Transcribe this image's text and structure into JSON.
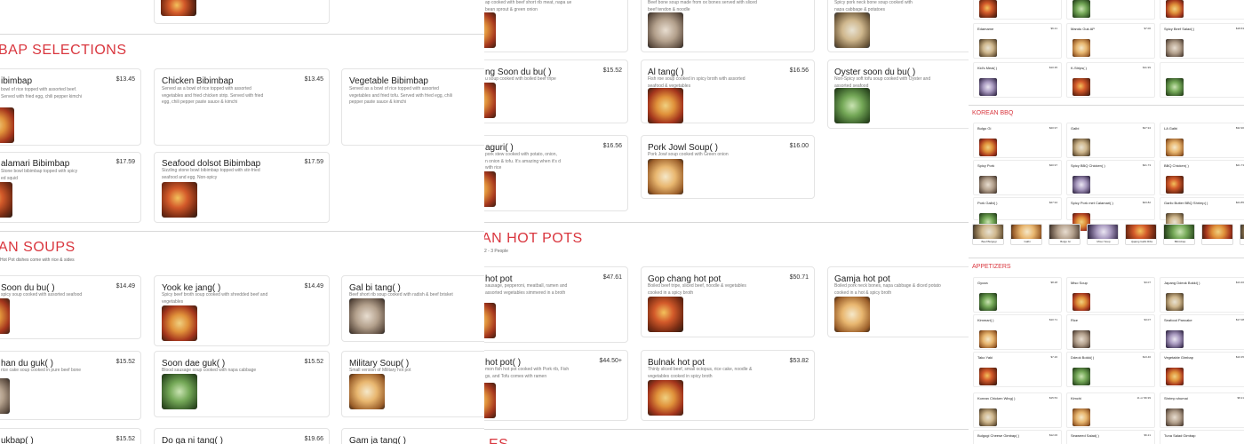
{
  "panel1": {
    "bap": {
      "title": "BAP SELECTIONS",
      "items": [
        {
          "name": "ibimbap",
          "price": "$13.45",
          "desc": "bowl of rice topped with assorted beef. Served with fried egg, chili pepper kimchi"
        },
        {
          "name": "Chicken Bibimbap",
          "price": "$13.45",
          "desc": "Served as a bowl of rice topped with assorted vegetables and fried chicken strip. Served with fried egg, chili pepper paste sauce & kimchi"
        },
        {
          "name": "Vegetable Bibimbap",
          "price": "",
          "desc": "Served as a bowl of rice topped with assorted vegetables and fried tofu. Served with fried egg, chili pepper paste sauce & kimchi"
        },
        {
          "name": "alamari Bibimbap",
          "price": "$17.59",
          "desc": "Stone bowl bibimbap topped with spicy ed squid"
        },
        {
          "name": "Seafood dolsot Bibimbap",
          "price": "$17.59",
          "desc": "Sizzling stone bowl bibimbap topped with stir-fried seafood and egg. Non-spicy"
        }
      ]
    },
    "soups": {
      "title": "AN SOUPS",
      "subtitle": "Hot Pot dishes come with rice & sides",
      "items": [
        {
          "name": "Soon du bu(   )",
          "price": "$14.49",
          "desc": "spicy soup cooked with assorted seafood"
        },
        {
          "name": "Yook ke jang(   )",
          "price": "$14.49",
          "desc": "Spicy beef broth soup cooked with shredded beef and vegetables"
        },
        {
          "name": "Gal bi tang(   )",
          "price": "",
          "desc": "Beef short rib soup cooked with radish & beef brisket"
        },
        {
          "name": "han du guk(   )",
          "price": "$15.52",
          "desc": "rice cake soup cooked in pure beef bone"
        },
        {
          "name": "Soon dae guk(   )",
          "price": "$15.52",
          "desc": "Blood sausage soup cooked with napa cabbage"
        },
        {
          "name": "Military Soup(   )",
          "price": "",
          "desc": "Small version of Military hot pot"
        },
        {
          "name": "ukbap(   )",
          "price": "$15.52",
          "desc": ""
        },
        {
          "name": "Do ga ni tang(   )",
          "price": "$19.66",
          "desc": ""
        },
        {
          "name": "Gam ja tang(   )",
          "price": "",
          "desc": ""
        }
      ]
    }
  },
  "panel2": {
    "top": [
      {
        "name": "",
        "price": "",
        "desc": "ap cooked with beef short rib meat, napa ue bean sprout & green onion"
      },
      {
        "name": "",
        "price": "",
        "desc": "Beef bone soup made from ox bones served with sliced beef tendon & noodle"
      },
      {
        "name": "",
        "price": "",
        "desc": "Spicy pork neck bone soup cooked with napa cabbage & potatoes"
      }
    ],
    "soups2": [
      {
        "name": "ng Soon du bu(   )",
        "price": "$15.52",
        "desc": "u soup cooked with boiled beef tripe"
      },
      {
        "name": "Al tang(   )",
        "price": "$16.56",
        "desc": "Fish roe soup cooked in spicy broth with assorted seafood & vegetables"
      },
      {
        "name": "Oyster soon du bu(   )",
        "price": "",
        "desc": "Non-Spicy soft tofu soup cooked with Oyster and assorted seafood"
      },
      {
        "name": "aguri(   )",
        "price": "$16.56",
        "desc": "pork stew cooked with potato, onion, n onion & tofu. It's amazing when it's d with rice"
      },
      {
        "name": "Pork Jowl Soup(   )",
        "price": "$16.00",
        "desc": "Pork Jowl soup cooked with Green onion"
      }
    ],
    "hotpots": {
      "title": "AN HOT POTS",
      "subtitle": "2 - 3 People",
      "items": [
        {
          "name": "hot pot",
          "price": "$47.61",
          "desc": "sausage, pepperoni, meatball, ramen and assorted vegetables simmered in a broth"
        },
        {
          "name": "Gop chang hot pot",
          "price": "$50.71",
          "desc": "Boiled beef tripe, sliced beef, noodle & vegetables cooked in a spicy broth"
        },
        {
          "name": "Gamja hot pot",
          "price": "",
          "desc": "Boiled pork neck bones, napa cabbage & diced potato cooked in a hot & spicy broth"
        },
        {
          "name": "hot pot(   )",
          "price": "$44.50+",
          "desc": "mon fish hot pot cooked with Pork rib, Fish gs, and Tofu comes with ramen"
        },
        {
          "name": "Bulnak hot pot",
          "price": "$53.82",
          "desc": "Thinly sliced beef, small octopus, rice cake, noodle & vegetables cooked in spicy broth"
        }
      ]
    },
    "bottom_title": "ES"
  },
  "panel3": {
    "top_rows": [
      [
        {
          "name": "",
          "price": ""
        },
        {
          "name": "",
          "price": ""
        },
        {
          "name": "",
          "price": ""
        }
      ],
      [
        {
          "name": "Edamame",
          "price": "$6.21"
        },
        {
          "name": "Mandu Guk AP",
          "price": "$7.00"
        },
        {
          "name": "Spicy Beef Salad(   )",
          "price": "$18.63"
        }
      ],
      [
        {
          "name": "Kid's Meal(   )",
          "price": "$10.35"
        },
        {
          "name": "K-Strips(   )",
          "price": "$11.99"
        },
        {
          "name": "",
          "price": ""
        }
      ]
    ],
    "bbq": {
      "title": "KOREAN BBQ",
      "rows": [
        [
          {
            "name": "Bulgo Gi",
            "price": "$20.97"
          },
          {
            "name": "Galbi",
            "price": "$27.94"
          },
          {
            "name": "LA Galbi",
            "price": "$32.90"
          }
        ],
        [
          {
            "name": "Spicy Pork",
            "price": "$20.97"
          },
          {
            "name": "Spicy BBQ Chicken(   )",
            "price": "$21.73"
          },
          {
            "name": "BBQ Chicken(   )",
            "price": "$21.73"
          }
        ],
        [
          {
            "name": "Pork Galbi(   )",
            "price": "$27.94"
          },
          {
            "name": "Spicy Pork met Calamari(   )",
            "price": "$23.82"
          },
          {
            "name": "Garlic Butter BBQ Shrimp(   )",
            "price": "$24.85"
          }
        ]
      ]
    },
    "strip": [
      "Beef Bulgogi",
      "Galbi",
      "Bulgo Gi",
      "Mixer Soup",
      "Jjajang Galbi Ribs",
      "Bibimbap",
      "",
      "Rice"
    ],
    "appetizers": {
      "title": "APPETIZERS",
      "rows": [
        [
          {
            "name": "Gyoza",
            "price": "$8.28"
          },
          {
            "name": "Miso Soup",
            "price": "$3.07"
          },
          {
            "name": "Japang Ddeok Bokki(   )",
            "price": "$13.46"
          }
        ],
        [
          {
            "name": "Kimmari(   )",
            "price": "$10.71"
          },
          {
            "name": "Rice",
            "price": "$3.07"
          },
          {
            "name": "Seafood Pancake",
            "price": "$17.08"
          }
        ],
        [
          {
            "name": "Tako Yaki",
            "price": "$7.26"
          },
          {
            "name": "Ddeok Bokki(   )",
            "price": "$13.46"
          },
          {
            "name": "Vegetable Gimbap",
            "price": "$10.35"
          }
        ],
        [
          {
            "name": "Korean Chicken Wing(   )",
            "price": "$15.53"
          },
          {
            "name": "Kimchi",
            "price": "11 oz $6.99"
          },
          {
            "name": "Shrimp shumai",
            "price": "$8.21"
          }
        ],
        [
          {
            "name": "Bulgogi Cheese Gimbap(   )",
            "price": "$12.06"
          },
          {
            "name": "Seaweed Salad(   )",
            "price": "$6.21"
          },
          {
            "name": "Tuna Salad Gimbap",
            "price": ""
          }
        ]
      ]
    }
  }
}
